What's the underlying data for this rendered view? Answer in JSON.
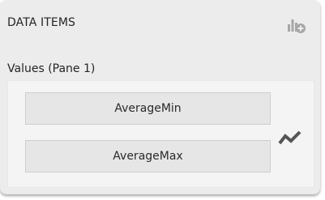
{
  "header": {
    "title": "DATA ITEMS",
    "add_icon": "bar-chart-add-icon"
  },
  "section": {
    "title": "Values (Pane 1)"
  },
  "items": [
    {
      "label": "AverageMin"
    },
    {
      "label": "AverageMax"
    }
  ],
  "series_type_icon": "line-series-icon",
  "colors": {
    "panel_background": "#ececec",
    "pane_background": "#f4f4f4",
    "item_background": "#e6e6e6",
    "item_border": "#cdcdcd",
    "icon_gray": "#9a9a9a",
    "icon_dark": "#555555"
  }
}
